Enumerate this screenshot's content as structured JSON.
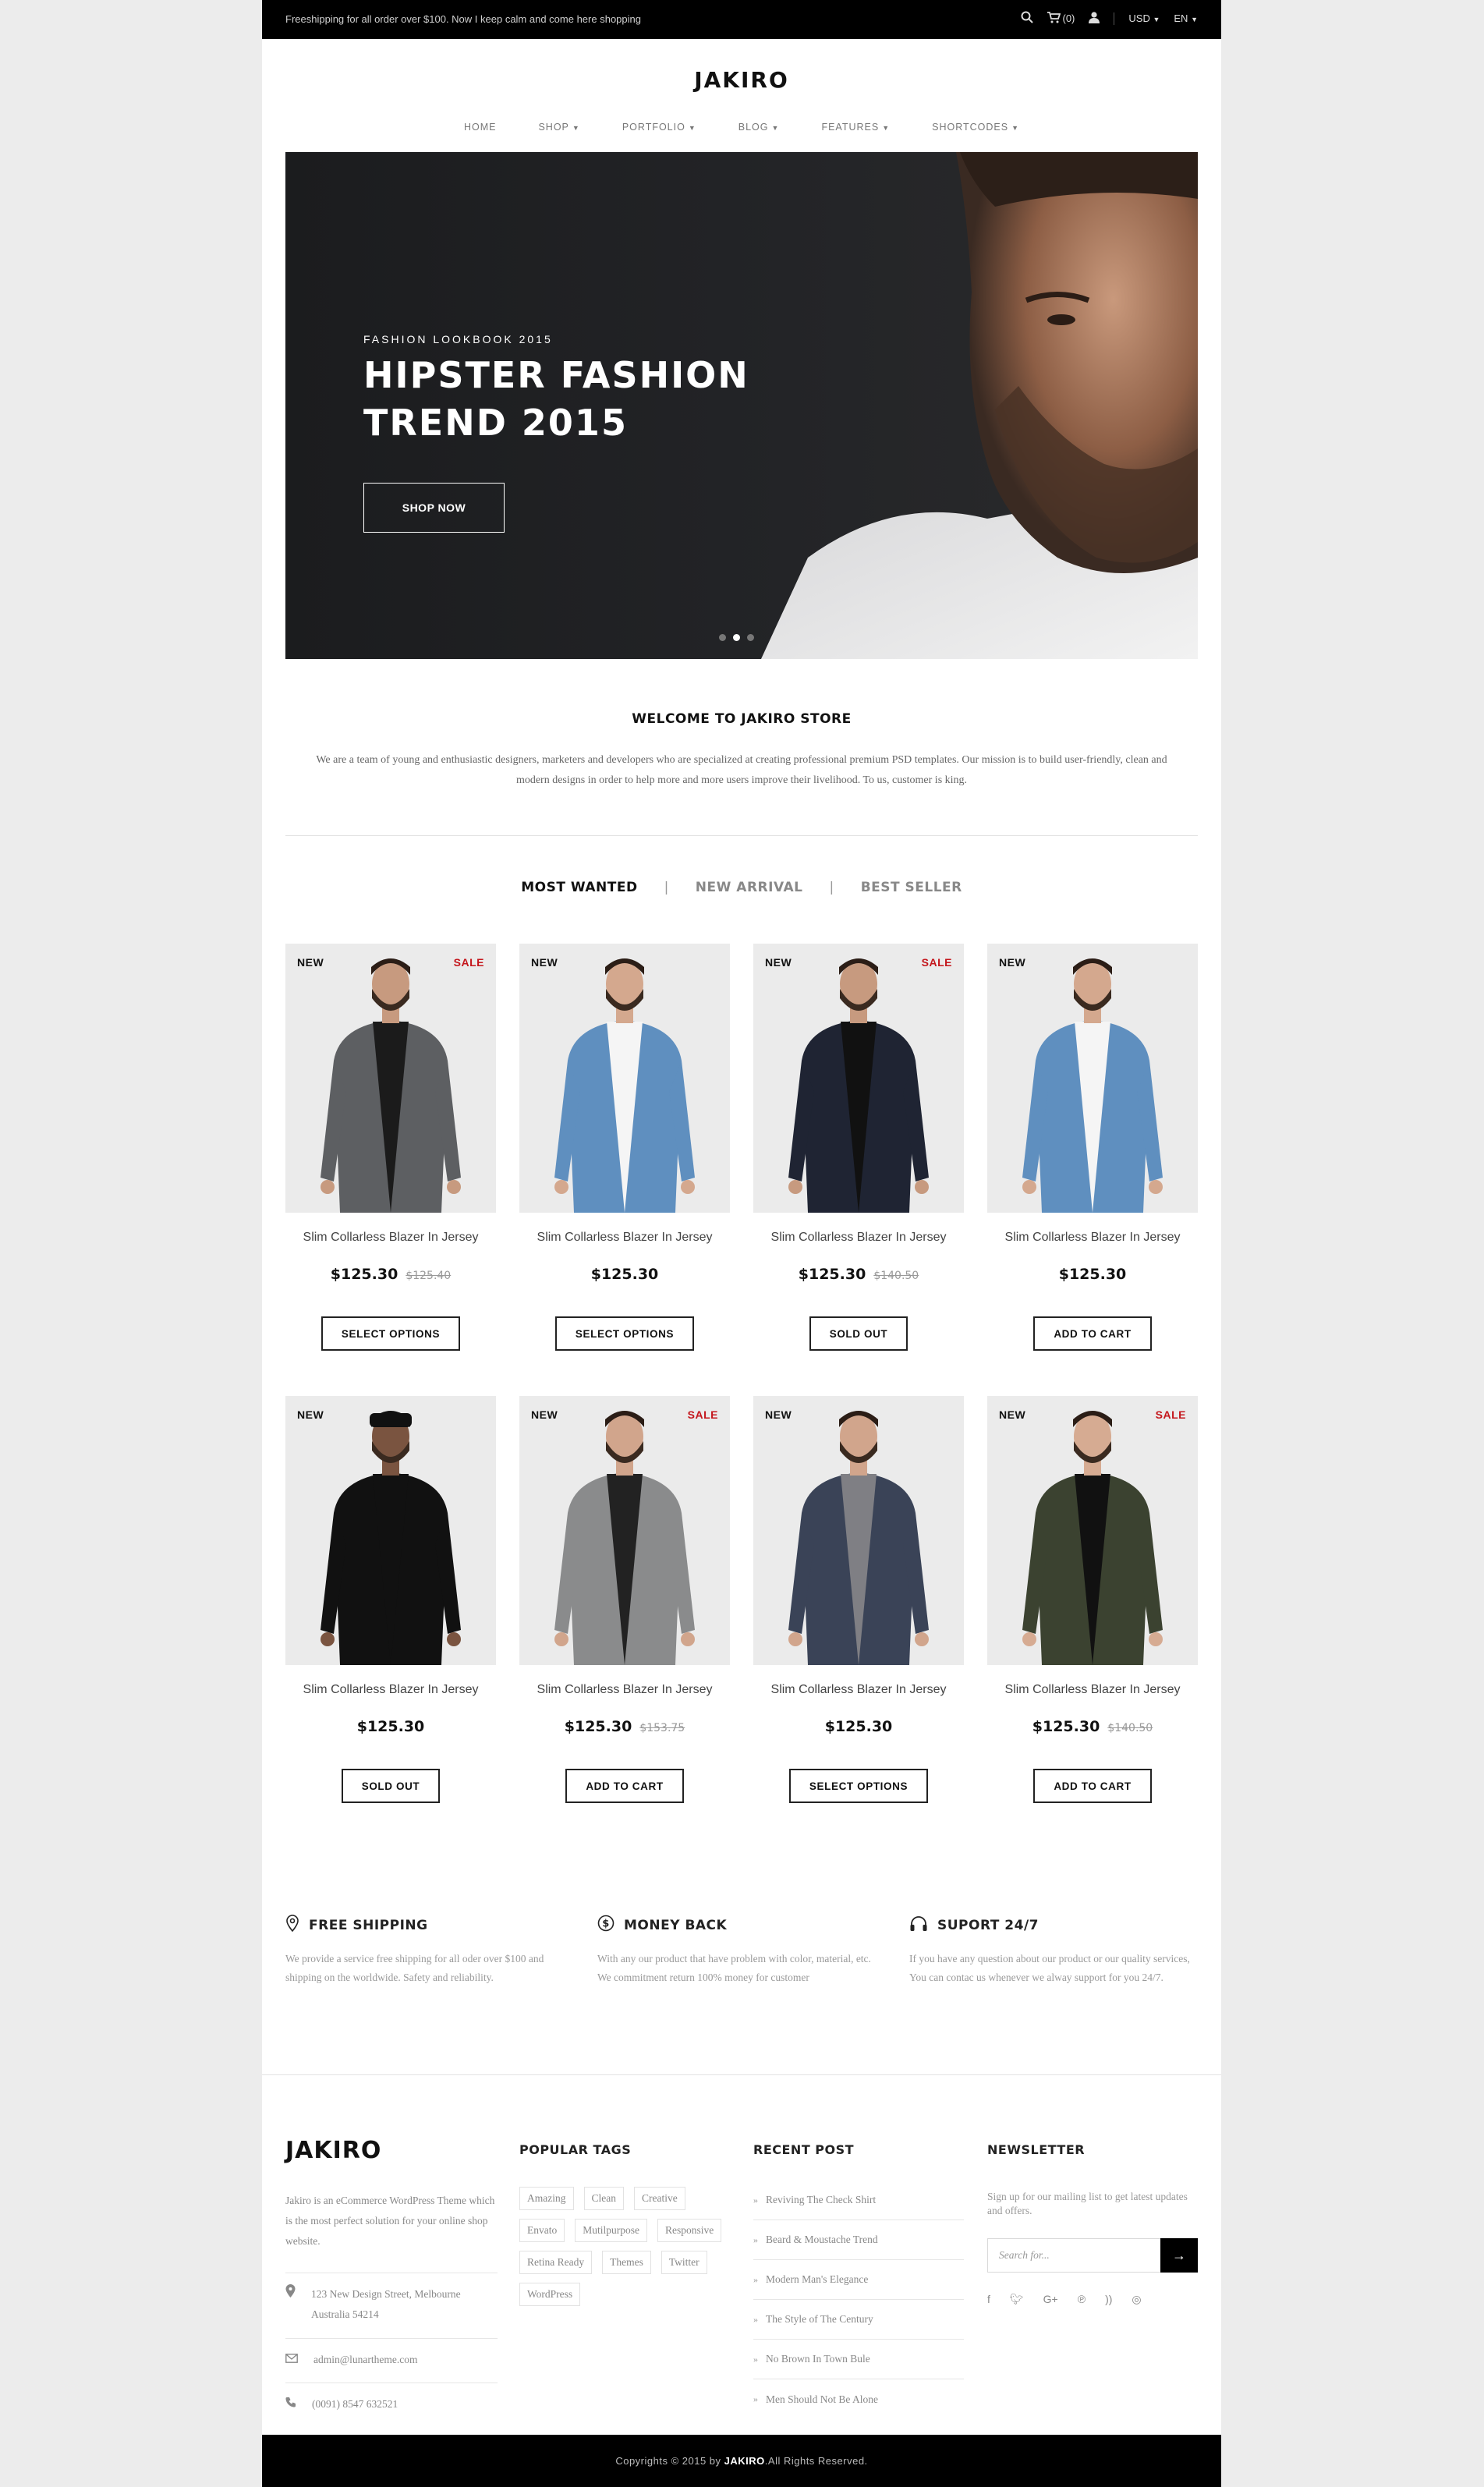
{
  "topbar": {
    "message": "Freeshipping for all order over $100. Now I keep calm and come here shopping",
    "cart_count": "(0)",
    "currency": "USD",
    "language": "EN"
  },
  "header": {
    "logo": "JAKIRO",
    "nav": [
      "HOME",
      "SHOP",
      "PORTFOLIO",
      "BLOG",
      "FEATURES",
      "SHORTCODES"
    ]
  },
  "hero": {
    "kicker": "FASHION LOOKBOOK 2015",
    "title_line1": "HIPSTER FASHION",
    "title_line2": "TREND 2015",
    "button": "SHOP NOW"
  },
  "welcome": {
    "title": "WELCOME TO JAKIRO STORE",
    "text": "We are a team of young and enthusiastic designers, marketers and developers who are specialized at creating professional premium PSD templates. Our mission is to build user-friendly, clean and modern designs in order to help more and more users improve their livelihood. To us, customer is king."
  },
  "tabs": [
    "MOST WANTED",
    "NEW ARRIVAL",
    "BEST SELLER"
  ],
  "products": [
    {
      "name": "Slim Collarless Blazer In Jersey",
      "price": "$125.30",
      "old_price": "$125.40",
      "new": "NEW",
      "sale": "SALE",
      "button": "SELECT OPTIONS"
    },
    {
      "name": "Slim Collarless Blazer In Jersey",
      "price": "$125.30",
      "old_price": "",
      "new": "NEW",
      "sale": "",
      "button": "SELECT OPTIONS"
    },
    {
      "name": "Slim Collarless Blazer In Jersey",
      "price": "$125.30",
      "old_price": "$140.50",
      "new": "NEW",
      "sale": "SALE",
      "button": "SOLD OUT"
    },
    {
      "name": "Slim Collarless Blazer In Jersey",
      "price": "$125.30",
      "old_price": "",
      "new": "NEW",
      "sale": "",
      "button": "ADD TO CART"
    },
    {
      "name": "Slim Collarless Blazer In Jersey",
      "price": "$125.30",
      "old_price": "",
      "new": "NEW",
      "sale": "",
      "button": "SOLD OUT"
    },
    {
      "name": "Slim Collarless Blazer In Jersey",
      "price": "$125.30",
      "old_price": "$153.75",
      "new": "NEW",
      "sale": "SALE",
      "button": "ADD TO CART"
    },
    {
      "name": "Slim Collarless Blazer In Jersey",
      "price": "$125.30",
      "old_price": "",
      "new": "NEW",
      "sale": "",
      "button": "SELECT OPTIONS"
    },
    {
      "name": "Slim Collarless Blazer In Jersey",
      "price": "$125.30",
      "old_price": "$140.50",
      "new": "NEW",
      "sale": "SALE",
      "button": "ADD TO CART"
    }
  ],
  "features": [
    {
      "icon": "map-pin-icon",
      "title": "FREE SHIPPING",
      "text": "We provide a service free shipping for all oder over $100 and shipping on the worldwide. Safety and reliability."
    },
    {
      "icon": "dollar-icon",
      "title": "MONEY BACK",
      "text": "With any our product that have problem with color, material, etc. We commitment return 100% money for customer"
    },
    {
      "icon": "headphones-icon",
      "title": "SUPORT 24/7",
      "text": "If you have any question about our product or our quality services, You can contac us whenever we alway support for you 24/7."
    }
  ],
  "footer": {
    "logo": "JAKIRO",
    "about": "Jakiro is an eCommerce WordPress Theme which is the most perfect solution for your online shop website.",
    "address_line1": "123 New Design Street, Melbourne",
    "address_line2": "Australia 54214",
    "email": "admin@lunartheme.com",
    "phone": "(0091) 8547 632521",
    "tags_title": "POPULAR TAGS",
    "tags": [
      "Amazing",
      "Clean",
      "Creative",
      "Envato",
      "Mutilpurpose",
      "Responsive",
      "Retina Ready",
      "Themes",
      "Twitter",
      "WordPress"
    ],
    "posts_title": "RECENT POST",
    "posts": [
      "Reviving The Check Shirt",
      "Beard & Moustache Trend",
      "Modern Man's Elegance",
      "The Style of The Century",
      "No Brown In Town Bule",
      "Men Should Not Be Alone"
    ],
    "newsletter_title": "NEWSLETTER",
    "newsletter_text": "Sign up for our mailing list to get latest updates and offers.",
    "newsletter_placeholder": "Search for...",
    "social": [
      "facebook-icon",
      "twitter-icon",
      "google-plus-icon",
      "pinterest-icon",
      "rss-icon",
      "instagram-icon"
    ]
  },
  "copyright_prefix": "Copyrights © 2015 by ",
  "copyright_brand": "JAKIRO",
  "copyright_suffix": ".All Rights Reserved."
}
